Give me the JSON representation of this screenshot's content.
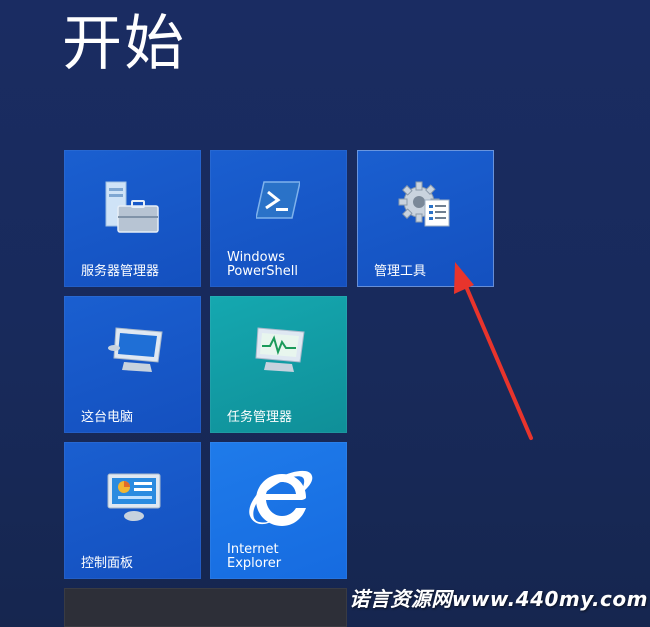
{
  "start": {
    "title": "开始"
  },
  "tiles": [
    {
      "label": "服务器管理器",
      "icon": "server-manager-icon",
      "color": "#1a5fd0"
    },
    {
      "label": "Windows\nPowerShell",
      "icon": "powershell-icon",
      "color": "#1a5fd0"
    },
    {
      "label": "管理工具",
      "icon": "administrative-tools-icon",
      "color": "#1a5fd0"
    },
    {
      "label": "这台电脑",
      "icon": "computer-icon",
      "color": "#1a5fd0"
    },
    {
      "label": "任务管理器",
      "icon": "task-manager-icon",
      "color": "#15a8b0"
    },
    {
      "label": "控制面板",
      "icon": "control-panel-icon",
      "color": "#1a5fd0"
    },
    {
      "label": "Internet\nExplorer",
      "icon": "internet-explorer-icon",
      "color": "#1f7bea"
    }
  ],
  "annotation": {
    "arrow_color": "#e8342c"
  },
  "watermark": {
    "text": "诺言资源网www.440my.com"
  },
  "colors": {
    "background": "#1a2b5e",
    "tile_blue": "#1a5fd0",
    "tile_teal": "#15a8b0",
    "tile_sky": "#1f7bea"
  }
}
